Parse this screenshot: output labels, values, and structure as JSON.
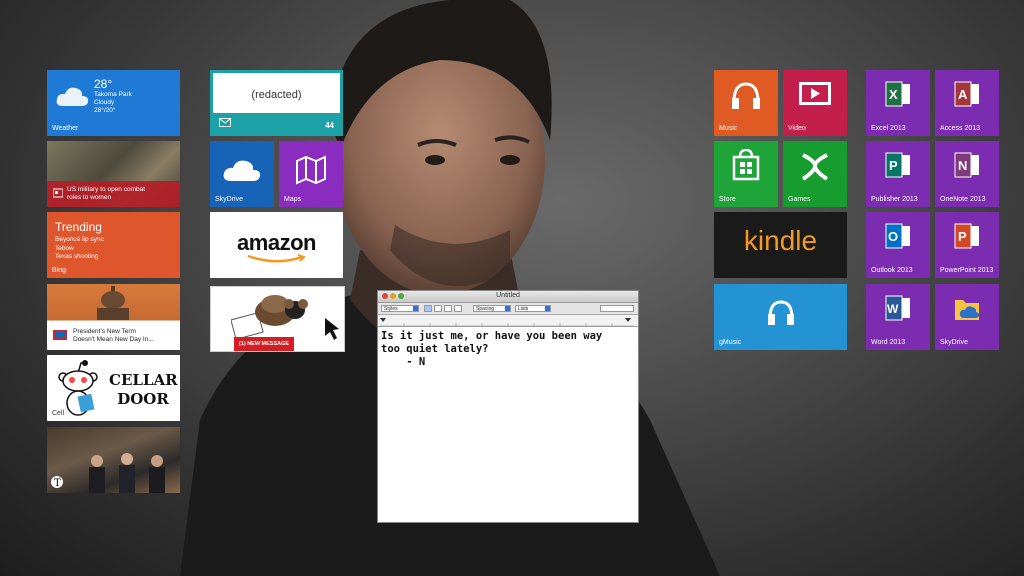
{
  "left_column": {
    "weather": {
      "temp": "28°",
      "city": "Takoma Park",
      "condition": "Cloudy",
      "range": "28°/20°",
      "label": "Weather"
    },
    "news": {
      "headline_line1": "US military to open combat",
      "headline_line2": "roles to women"
    },
    "trending": {
      "heading": "Trending",
      "items": [
        "Beyoncé lip sync",
        "Tebow",
        "Texas shooting"
      ],
      "label": "Bing"
    },
    "capitol_news": {
      "line1": "President's New Term",
      "line2": "Doesn't Mean New Day In..."
    },
    "reddit": {
      "line1": "CELLAR",
      "line2": "DOOR",
      "label": "Cell"
    }
  },
  "mid_column": {
    "mail": {
      "text": "(redacted)",
      "count": "44"
    },
    "skydrive": {
      "label": "SkyDrive"
    },
    "maps": {
      "label": "Maps"
    },
    "amazon": {
      "word": "amazon"
    },
    "sheep": {
      "button": "(1) NEW MESSAGE"
    }
  },
  "right_group": {
    "music": "Music",
    "video": "Video",
    "store": "Store",
    "games": "Games",
    "kindle": "kindle",
    "gmusic": "gMusic"
  },
  "office_group": [
    {
      "label": "Excel 2013",
      "letter": "X",
      "color": "#1e7145"
    },
    {
      "label": "Access 2013",
      "letter": "A",
      "color": "#a4373a"
    },
    {
      "label": "Publisher 2013",
      "letter": "P",
      "color": "#077568"
    },
    {
      "label": "OneNote 2013",
      "letter": "N",
      "color": "#80397b"
    },
    {
      "label": "Outlook 2013",
      "letter": "O",
      "color": "#0072c6"
    },
    {
      "label": "PowerPoint 2013",
      "letter": "P",
      "color": "#d24726"
    },
    {
      "label": "Word 2013",
      "letter": "W",
      "color": "#2b579a"
    },
    {
      "label": "SkyDrive",
      "letter": "",
      "color": "#f5c342"
    }
  ],
  "editor": {
    "title": "Untitled",
    "styles": "Styles",
    "spacing": "Spacing",
    "lists": "Lists",
    "text_line1": "Is it just me, or have you been way",
    "text_line2": "too quiet lately?",
    "text_line3": "    - N"
  }
}
